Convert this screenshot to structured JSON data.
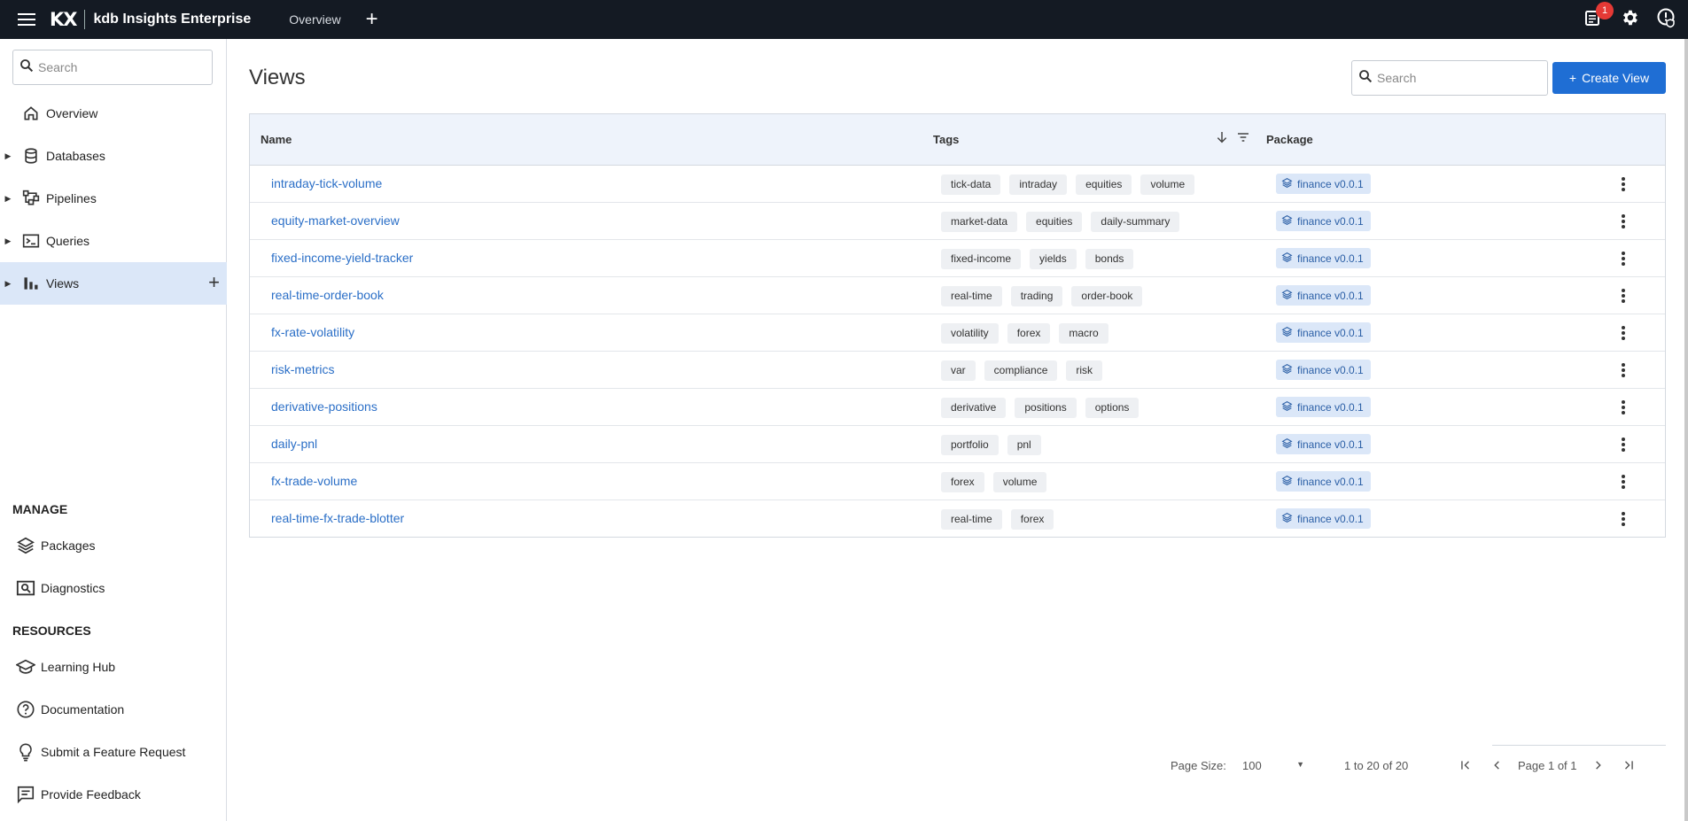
{
  "topbar": {
    "logo": "KX",
    "app_name": "kdb Insights Enterprise",
    "tab": "Overview",
    "add": "+",
    "notification_count": "1"
  },
  "sidebar": {
    "search_placeholder": "Search",
    "items": [
      {
        "label": "Overview",
        "icon": "home-icon"
      },
      {
        "label": "Databases",
        "icon": "database-icon"
      },
      {
        "label": "Pipelines",
        "icon": "pipeline-icon"
      },
      {
        "label": "Queries",
        "icon": "terminal-icon"
      },
      {
        "label": "Views",
        "icon": "bar-chart-icon",
        "active": true
      }
    ],
    "manage_heading": "MANAGE",
    "manage": [
      {
        "label": "Packages",
        "icon": "layers-icon"
      },
      {
        "label": "Diagnostics",
        "icon": "diagnostics-icon"
      }
    ],
    "resources_heading": "RESOURCES",
    "resources": [
      {
        "label": "Learning Hub",
        "icon": "graduation-cap-icon"
      },
      {
        "label": "Documentation",
        "icon": "help-circle-icon"
      },
      {
        "label": "Submit a Feature Request",
        "icon": "lightbulb-icon"
      },
      {
        "label": "Provide Feedback",
        "icon": "feedback-icon"
      }
    ]
  },
  "main": {
    "title": "Views",
    "search_placeholder": "Search",
    "create_label": "Create View",
    "columns": {
      "name": "Name",
      "tags": "Tags",
      "package": "Package"
    },
    "rows": [
      {
        "name": "intraday-tick-volume",
        "tags": [
          "tick-data",
          "intraday",
          "equities",
          "volume"
        ],
        "package": "finance v0.0.1"
      },
      {
        "name": "equity-market-overview",
        "tags": [
          "market-data",
          "equities",
          "daily-summary"
        ],
        "package": "finance v0.0.1"
      },
      {
        "name": "fixed-income-yield-tracker",
        "tags": [
          "fixed-income",
          "yields",
          "bonds"
        ],
        "package": "finance v0.0.1"
      },
      {
        "name": "real-time-order-book",
        "tags": [
          "real-time",
          "trading",
          "order-book"
        ],
        "package": "finance v0.0.1"
      },
      {
        "name": "fx-rate-volatility",
        "tags": [
          "volatility",
          "forex",
          "macro"
        ],
        "package": "finance v0.0.1"
      },
      {
        "name": "risk-metrics",
        "tags": [
          "var",
          "compliance",
          "risk"
        ],
        "package": "finance v0.0.1"
      },
      {
        "name": "derivative-positions",
        "tags": [
          "derivative",
          "positions",
          "options"
        ],
        "package": "finance v0.0.1"
      },
      {
        "name": "daily-pnl",
        "tags": [
          "portfolio",
          "pnl"
        ],
        "package": "finance v0.0.1"
      },
      {
        "name": "fx-trade-volume",
        "tags": [
          "forex",
          "volume"
        ],
        "package": "finance v0.0.1"
      },
      {
        "name": "real-time-fx-trade-blotter",
        "tags": [
          "real-time",
          "forex"
        ],
        "package": "finance v0.0.1"
      }
    ],
    "pager": {
      "page_size_label": "Page Size:",
      "page_size": "100",
      "range": "1 to 20 of 20",
      "page_text": "Page 1 of 1"
    }
  }
}
